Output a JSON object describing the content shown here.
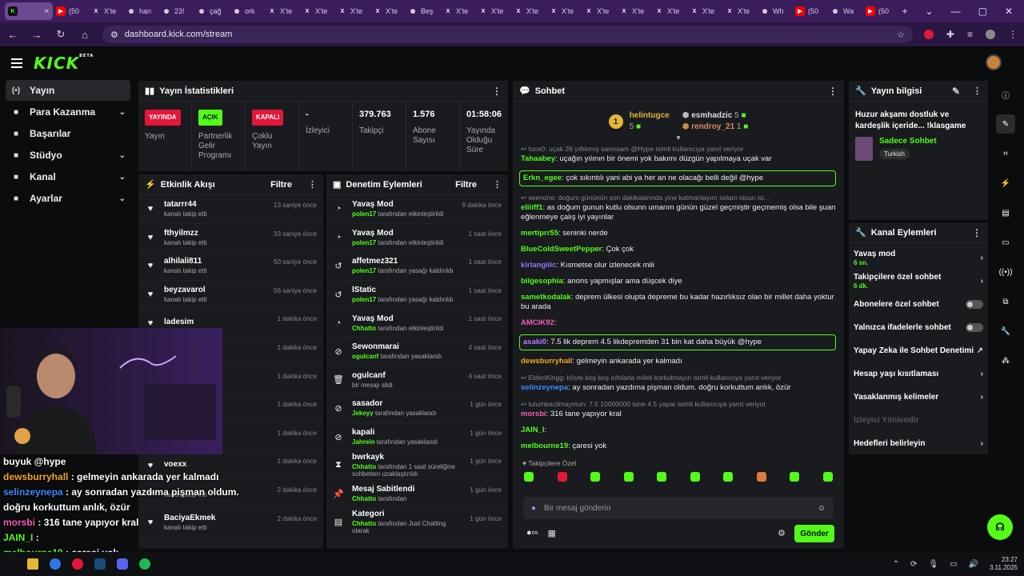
{
  "browser": {
    "tabs": [
      {
        "label": "",
        "icon": "kick-logo-icon",
        "color": "#53fc18",
        "active": true
      },
      {
        "label": "(50",
        "icon": "youtube-icon",
        "color": "#ff0000"
      },
      {
        "label": "X'te",
        "icon": "x-icon",
        "color": "#ffffff"
      },
      {
        "label": "han",
        "icon": "globe-icon",
        "color": "#ffffff"
      },
      {
        "label": "23!",
        "icon": "globe-icon",
        "color": "#ffffff"
      },
      {
        "label": "çağ",
        "icon": "globe-icon",
        "color": "#ffffff"
      },
      {
        "label": "ork",
        "icon": "globe-icon",
        "color": "#ffffff"
      },
      {
        "label": "X'te",
        "icon": "x-icon",
        "color": "#ffffff"
      },
      {
        "label": "X'te",
        "icon": "x-icon",
        "color": "#ffffff"
      },
      {
        "label": "X'te",
        "icon": "x-icon",
        "color": "#ffffff"
      },
      {
        "label": "X'te",
        "icon": "x-icon",
        "color": "#ffffff"
      },
      {
        "label": "Beş",
        "icon": "doc-icon",
        "color": "#ffffff"
      },
      {
        "label": "X'te",
        "icon": "x-icon",
        "color": "#ffffff"
      },
      {
        "label": "X'te",
        "icon": "x-icon",
        "color": "#ffffff"
      },
      {
        "label": "X'te",
        "icon": "x-icon",
        "color": "#ffffff"
      },
      {
        "label": "X'te",
        "icon": "x-icon",
        "color": "#ffffff"
      },
      {
        "label": "X'te",
        "icon": "x-icon",
        "color": "#ffffff"
      },
      {
        "label": "X'te",
        "icon": "x-icon",
        "color": "#ffffff"
      },
      {
        "label": "X'te",
        "icon": "x-icon",
        "color": "#ffffff"
      },
      {
        "label": "X'te",
        "icon": "x-icon",
        "color": "#ffffff"
      },
      {
        "label": "X'te",
        "icon": "x-icon",
        "color": "#ffffff"
      },
      {
        "label": "Wh",
        "icon": "globe-icon",
        "color": "#ffffff"
      },
      {
        "label": "(50",
        "icon": "youtube-icon",
        "color": "#ff0000"
      },
      {
        "label": "Wa",
        "icon": "globe-icon",
        "color": "#4aa3ff"
      },
      {
        "label": "(50",
        "icon": "youtube-icon",
        "color": "#ff0000"
      }
    ],
    "url": "dashboard.kick.com/stream"
  },
  "nav": {
    "items": [
      {
        "label": "Yayın",
        "icon": "broadcast-icon",
        "selected": true,
        "expandable": false
      },
      {
        "label": "Para Kazanma",
        "icon": "money-icon",
        "expandable": true
      },
      {
        "label": "Başarılar",
        "icon": "trophy-icon",
        "expandable": false
      },
      {
        "label": "Stüdyo",
        "icon": "studio-icon",
        "expandable": true
      },
      {
        "label": "Kanal",
        "icon": "channel-icon",
        "expandable": true
      },
      {
        "label": "Ayarlar",
        "icon": "gear-icon",
        "expandable": true
      }
    ]
  },
  "stats": {
    "title": "Yayın İstatistikleri",
    "cells": [
      {
        "badge": "YAYINDA",
        "badge_color": "#e4163a",
        "label": "Yayın"
      },
      {
        "badge": "AÇIK",
        "badge_color": "#53fc18",
        "label": "Partnerlik Gelir Programı"
      },
      {
        "badge": "KAPALI",
        "badge_color": "#e4163a",
        "label": "Çoklu Yayın"
      },
      {
        "value": "-",
        "label": "İzleyici"
      },
      {
        "value": "379.763",
        "label": "Takipçi"
      },
      {
        "value": "1.576",
        "label": "Abone Sayısı"
      },
      {
        "value": "01:58:06",
        "label": "Yayında Olduğu Süre"
      }
    ]
  },
  "activity": {
    "title": "Etkinlik Akışı",
    "filter": "Filtre",
    "rows": [
      {
        "name": "tatarrr44",
        "sub": "kanalı takip etti",
        "time": "13 saniye önce"
      },
      {
        "name": "fthyilmzz",
        "sub": "kanalı takip etti",
        "time": "33 saniye önce"
      },
      {
        "name": "alhilali811",
        "sub": "kanalı takip etti",
        "time": "50 saniye önce"
      },
      {
        "name": "beyzavarol",
        "sub": "kanalı takip etti",
        "time": "56 saniye önce"
      },
      {
        "name": "ladesim",
        "sub": "",
        "time": "1 dakika önce"
      },
      {
        "name": "",
        "sub": "",
        "time": "1 dakika önce"
      },
      {
        "name": "",
        "sub": "",
        "time": "1 dakika önce"
      },
      {
        "name": "",
        "sub": "",
        "time": "1 dakika önce"
      },
      {
        "name": "",
        "sub": "",
        "time": "1 dakika önce"
      },
      {
        "name": "voexx",
        "sub": "",
        "time": "1 dakika önce"
      },
      {
        "name": "",
        "sub": "kanalı takip etti",
        "time": "2 dakika önce"
      },
      {
        "name": "BaciyaEkmek",
        "sub": "kanalı takip etti",
        "time": "2 dakika önce"
      }
    ]
  },
  "moderation": {
    "title": "Denetim Eylemleri",
    "filter": "Filtre",
    "rows": [
      {
        "icon": "slow-mode-icon",
        "name": "Yavaş Mod",
        "actor": "polen17",
        "sub": "tarafından etkinleştirildi",
        "time": "9 dakika önce"
      },
      {
        "icon": "slow-mode-icon",
        "name": "Yavaş Mod",
        "actor": "polen17",
        "sub": "tarafından etkinleştirildi",
        "time": "1 saat önce"
      },
      {
        "icon": "undo-icon",
        "name": "affetmez321",
        "actor": "polen17",
        "sub": "tarafından yasağı kaldırıldı",
        "time": "1 saat önce"
      },
      {
        "icon": "undo-icon",
        "name": "lStatic",
        "actor": "polen17",
        "sub": "tarafından yasağı kaldırıldı",
        "time": "1 saat önce"
      },
      {
        "icon": "slow-mode-icon",
        "name": "Yavaş Mod",
        "actor": "Chhatto",
        "sub": "tarafından etkinleştirildi",
        "time": "1 saat önce"
      },
      {
        "icon": "ban-icon",
        "name": "Sewonmarai",
        "actor": "ogulcanf",
        "sub": "tarafından yasaklandı",
        "time": "4 saat önce"
      },
      {
        "icon": "trash-icon",
        "name": "ogulcanf",
        "actor": "",
        "sub": "bir mesajı sildi",
        "time": "4 saat önce"
      },
      {
        "icon": "ban-icon",
        "name": "sasador",
        "actor": "Jekeyy",
        "sub": "tarafından yasaklandı",
        "time": "1 gün önce"
      },
      {
        "icon": "ban-icon",
        "name": "kapali",
        "actor": "Jahrein",
        "sub": "tarafından yasaklandı",
        "time": "1 gün önce"
      },
      {
        "icon": "hourglass-icon",
        "name": "bwrkayk",
        "actor": "Chhatto",
        "sub": "tarafından 1 saat süreliğine sohbetten uzaklaştırıldı",
        "time": "1 gün önce"
      },
      {
        "icon": "pin-icon",
        "name": "Mesaj Sabitlendi",
        "actor": "Chhatto",
        "sub": "tarafından",
        "time": "1 gün önce"
      },
      {
        "icon": "category-icon",
        "name": "Kategori",
        "actor": "Chhatto",
        "sub": "tarafından Just Chatting olarak",
        "time": "1 gün önce"
      }
    ]
  },
  "chat": {
    "title": "Sohbet",
    "pinned": {
      "rank": "1",
      "top_user": "helintugce",
      "top_count": "5",
      "second_user": "esmhadzic",
      "second_count": "5",
      "third_user": "rendroy_21",
      "third_count": "1"
    },
    "messages": [
      {
        "type": "reply",
        "text": "tuce0: uçak 26 yıllıkmış sanırsam @Hype isimli kullanıcıya yanıt veriyor"
      },
      {
        "user": "Tahaabey",
        "color": "#53fc18",
        "text": "uçağın yılının bir önemi yok bakımı düzgün yapılmaya uçak var"
      },
      {
        "user": "Erkn_egee",
        "color": "#53fc18",
        "text": "çok sıkıntılı yani abi ya her an ne olacağı belli değil @hype",
        "highlight": true
      },
      {
        "type": "reply",
        "text": "seenone: doğum gününün son dakikalarında yine katmanlayım selam olsun isi..."
      },
      {
        "user": "eliiiff1",
        "color": "#53fc18",
        "text": "as doğum gunun kutlu olsunn umarım günün güzel geçmiştir geçmemiş olsa bile şuan eğlenmeye çalış iyi yayınlar"
      },
      {
        "user": "mertiprr55",
        "color": "#53fc18",
        "text": "seninki nerde"
      },
      {
        "user": "BlueColdSweetPepper",
        "color": "#53fc18",
        "text": "Çok çok"
      },
      {
        "user": "kirlangiiic",
        "color": "#8a7dff",
        "text": "Kısmetse olur izlenecek miii"
      },
      {
        "user": "bilgesophia",
        "color": "#53fc18",
        "text": "anons yapmışlar ama düşcek diye"
      },
      {
        "user": "sametkodalak",
        "color": "#53fc18",
        "text": "deprem ülkesi olupta depreme bu kadar hazırlıksız olan bir millet daha yoktur bu arada"
      },
      {
        "user": "AMCIK92",
        "color": "#f25eb5",
        "text": ""
      },
      {
        "user": "asaki0",
        "color": "#b47dff",
        "text": "7.5 lik deprem 4.5 likdepremden 31 bin kat daha büyük @hype",
        "highlight": true
      },
      {
        "user": "dewsburryhall",
        "color": "#f5a623",
        "text": "gelmeyin ankarada yer kalmadı"
      },
      {
        "type": "reply",
        "text": "EldenKingg: böyle boş boş infolarla mileti korkutmayın isimli kullanıcıya yanıt veriyor"
      },
      {
        "user": "selinzeynepa",
        "color": "#3d8bff",
        "text": "ay sonradan yazdıma pişman oldum. doğru korkuttum anlık, özür"
      },
      {
        "type": "reply",
        "text": "tulumbacilmaymun: 7.5 10000000 tane 4.5 yapar isimli kullanıcıya yanıt veriyor"
      },
      {
        "user": "morsbi",
        "color": "#f25eb5",
        "text": "316 tane yapıyor kral"
      },
      {
        "user": "JAIN_I",
        "color": "#53fc18",
        "text": ""
      },
      {
        "user": "melbourne19",
        "color": "#53fc18",
        "text": "çaresi yok"
      }
    ],
    "followers_only_label": "Takipçilere Özel",
    "input_placeholder": "Bir mesaj gönderin",
    "send_label": "Gönder"
  },
  "info": {
    "title": "Yayın bilgisi",
    "stream_title": "Huzur akşamı dostluk ve kardeşlik içeride... !klasgame",
    "category": "Sadece Sohbet",
    "language": "Turkish"
  },
  "actions": {
    "title": "Kanal Eylemleri",
    "items": [
      {
        "label": "Yavaş mod",
        "sub": "6 sn.",
        "control": "chevron"
      },
      {
        "label": "Takipçilere özel sohbet",
        "sub": "6 dk.",
        "control": "chevron"
      },
      {
        "label": "Abonelere özel sohbet",
        "sub": "",
        "control": "toggle"
      },
      {
        "label": "Yalnızca ifadelerle sohbet",
        "sub": "",
        "control": "toggle"
      },
      {
        "label": "Yapay Zeka ile Sohbet Denetimi",
        "sub": "",
        "control": "external"
      },
      {
        "label": "Hesap yaşı kısıtlaması",
        "sub": "",
        "control": "chevron"
      },
      {
        "label": "Yasaklanmış kelimeler",
        "sub": "",
        "control": "chevron"
      },
      {
        "label": "İzleyici Yönlendir",
        "sub": "",
        "control": "disabled"
      },
      {
        "label": "Hedefleri belirleyin",
        "sub": "",
        "control": "chevron"
      }
    ]
  },
  "overlay": {
    "lines": [
      {
        "user": "",
        "text": "buyuk @hype"
      },
      {
        "user": "dewsburryhall",
        "color": "#f5a623",
        "text": ": gelmeyin ankarada yer kalmadı"
      },
      {
        "user": "selinzeynepa",
        "color": "#3d8bff",
        "text": ": ay sonradan yazdıma pişman oldum. doğru korkuttum anlık, özür"
      },
      {
        "user": "morsbi",
        "color": "#f25eb5",
        "text": ": 316 tane yapıyor kral"
      },
      {
        "user": "JAIN_I",
        "color": "#53fc18",
        "text": ":"
      },
      {
        "user": "melbourne19",
        "color": "#53fc18",
        "text": ": çaresi yok"
      }
    ]
  },
  "taskbar": {
    "time": "23:27",
    "date": "3.11.2025"
  },
  "colors": {
    "accent": "#53fc18",
    "live": "#e4163a",
    "tabbar": "#3b1d5c"
  }
}
